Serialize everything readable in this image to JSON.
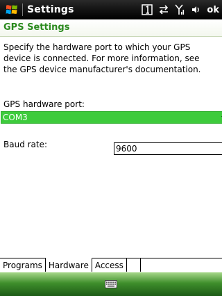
{
  "titlebar": {
    "title": "Settings",
    "tray_ok": "ok",
    "icons": [
      "windows-start-icon",
      "number-badge-icon",
      "connectivity-icon",
      "signal-icon",
      "volume-icon"
    ]
  },
  "page": {
    "header": "GPS Settings"
  },
  "description": "Specify the hardware port to which your GPS\ndevice is connected. For more information, see\nthe GPS device manufacturer's documentation.",
  "gps_port": {
    "label": "GPS hardware port:",
    "value": "COM3"
  },
  "baud": {
    "label": "Baud rate:",
    "value": "9600"
  },
  "tabs": [
    {
      "label": "Programs",
      "active": false
    },
    {
      "label": "Hardware",
      "active": true
    },
    {
      "label": "Access",
      "active": false
    }
  ],
  "softkeys": {
    "icon": "keyboard-icon"
  },
  "colors": {
    "accent_green": "#3dcb3c",
    "header_green": "#2b8a1e",
    "titlebar_black": "#111111"
  }
}
